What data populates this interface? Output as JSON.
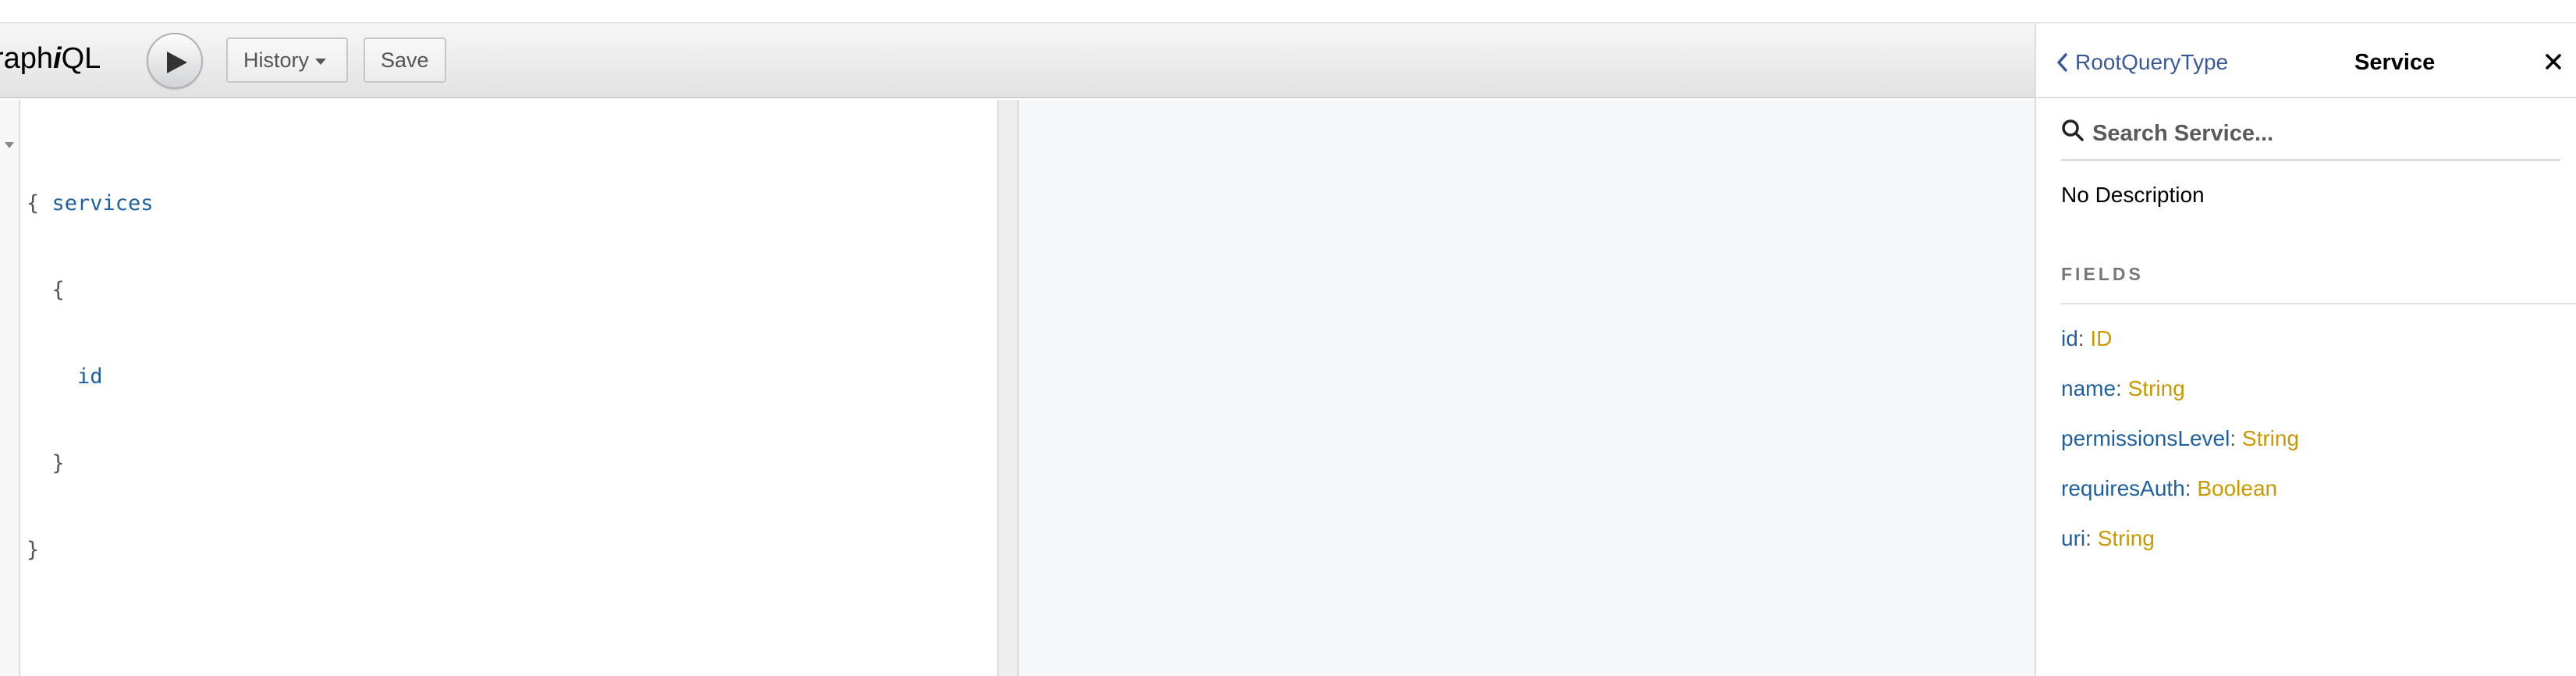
{
  "app": {
    "logo_prefix": "raph",
    "logo_italic": "i",
    "logo_suffix": "QL"
  },
  "toolbar": {
    "run_icon": "play-icon",
    "history_label": "History",
    "save_label": "Save"
  },
  "editor": {
    "lines": [
      {
        "open": "{ ",
        "keyword": "services",
        "close": ""
      },
      {
        "open": "  {",
        "keyword": "",
        "close": ""
      },
      {
        "open": "    ",
        "keyword": "id",
        "close": ""
      },
      {
        "open": "  }",
        "keyword": "",
        "close": ""
      },
      {
        "open": "}",
        "keyword": "",
        "close": ""
      }
    ]
  },
  "docs": {
    "back_label": "RootQueryType",
    "title": "Service",
    "close_icon": "close-icon",
    "search_placeholder": "Search Service...",
    "description": "No Description",
    "fields_title": "FIELDS",
    "fields": [
      {
        "name": "id",
        "type": "ID"
      },
      {
        "name": "name",
        "type": "String"
      },
      {
        "name": "permissionsLevel",
        "type": "String"
      },
      {
        "name": "requiresAuth",
        "type": "Boolean"
      },
      {
        "name": "uri",
        "type": "String"
      }
    ]
  },
  "colors": {
    "field_name": "#1f61a0",
    "field_type": "#ca9800",
    "link": "#3b5998"
  }
}
